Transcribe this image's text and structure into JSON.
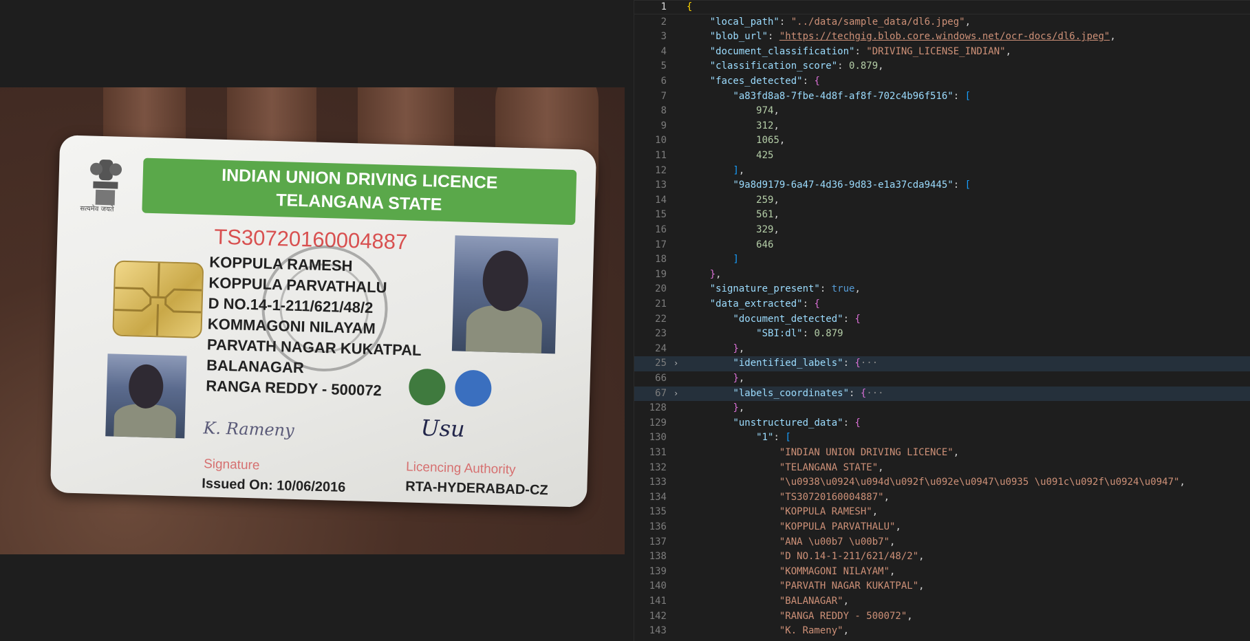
{
  "card": {
    "banner_line1": "INDIAN UNION DRIVING LICENCE",
    "banner_line2": "TELANGANA STATE",
    "emblem_caption": "सत्यमेव जयते",
    "licence_number": "TS30720160004887",
    "address_lines": [
      "KOPPULA  RAMESH",
      "KOPPULA PARVATHALU",
      "D NO.14-1-211/621/48/2",
      "KOMMAGONI NILAYAM",
      "PARVATH NAGAR KUKATPAL",
      "BALANAGAR",
      "RANGA REDDY - 500072"
    ],
    "signature_script": "K. Rameny",
    "authority_script": "Usu",
    "signature_label": "Signature",
    "licencing_label": "Licencing Authority",
    "issued_on": "Issued On: 10/06/2016",
    "rta": "RTA-HYDERABAD-CZ"
  },
  "editor": {
    "lines": [
      {
        "n": "1",
        "t": "{"
      },
      {
        "n": "2",
        "t": "    \"local_path\": \"../data/sample_data/dl6.jpeg\","
      },
      {
        "n": "3",
        "t": "    \"blob_url\": \"https://techgig.blob.core.windows.net/ocr-docs/dl6.jpeg\","
      },
      {
        "n": "4",
        "t": "    \"document_classification\": \"DRIVING_LICENSE_INDIAN\","
      },
      {
        "n": "5",
        "t": "    \"classification_score\": 0.879,"
      },
      {
        "n": "6",
        "t": "    \"faces_detected\": {"
      },
      {
        "n": "7",
        "t": "        \"a83fd8a8-7fbe-4d8f-af8f-702c4b96f516\": ["
      },
      {
        "n": "8",
        "t": "            974,"
      },
      {
        "n": "9",
        "t": "            312,"
      },
      {
        "n": "10",
        "t": "            1065,"
      },
      {
        "n": "11",
        "t": "            425"
      },
      {
        "n": "12",
        "t": "        ],"
      },
      {
        "n": "13",
        "t": "        \"9a8d9179-6a47-4d36-9d83-e1a37cda9445\": ["
      },
      {
        "n": "14",
        "t": "            259,"
      },
      {
        "n": "15",
        "t": "            561,"
      },
      {
        "n": "16",
        "t": "            329,"
      },
      {
        "n": "17",
        "t": "            646"
      },
      {
        "n": "18",
        "t": "        ]"
      },
      {
        "n": "19",
        "t": "    },"
      },
      {
        "n": "20",
        "t": "    \"signature_present\": true,"
      },
      {
        "n": "21",
        "t": "    \"data_extracted\": {"
      },
      {
        "n": "22",
        "t": "        \"document_detected\": {"
      },
      {
        "n": "23",
        "t": "            \"SBI:dl\": 0.879"
      },
      {
        "n": "24",
        "t": "        },"
      },
      {
        "n": "25",
        "t": "        \"identified_labels\": {···"
      },
      {
        "n": "66",
        "t": "        },"
      },
      {
        "n": "67",
        "t": "        \"labels_coordinates\": {···"
      },
      {
        "n": "128",
        "t": "        },"
      },
      {
        "n": "129",
        "t": "        \"unstructured_data\": {"
      },
      {
        "n": "130",
        "t": "            \"1\": ["
      },
      {
        "n": "131",
        "t": "                \"INDIAN UNION DRIVING LICENCE\","
      },
      {
        "n": "132",
        "t": "                \"TELANGANA STATE\","
      },
      {
        "n": "133",
        "t": "                \"\\u0938\\u0924\\u094d\\u092f\\u092e\\u0947\\u0935 \\u091c\\u092f\\u0924\\u0947\","
      },
      {
        "n": "134",
        "t": "                \"TS30720160004887\","
      },
      {
        "n": "135",
        "t": "                \"KOPPULA RAMESH\","
      },
      {
        "n": "136",
        "t": "                \"KOPPULA PARVATHALU\","
      },
      {
        "n": "137",
        "t": "                \"ANA \\u00b7 \\u00b7\","
      },
      {
        "n": "138",
        "t": "                \"D NO.14-1-211/621/48/2\","
      },
      {
        "n": "139",
        "t": "                \"KOMMAGONI NILAYAM\","
      },
      {
        "n": "140",
        "t": "                \"PARVATH NAGAR KUKATPAL\","
      },
      {
        "n": "141",
        "t": "                \"BALANAGAR\","
      },
      {
        "n": "142",
        "t": "                \"RANGA REDDY - 500072\","
      },
      {
        "n": "143",
        "t": "                \"K. Rameny\","
      }
    ]
  }
}
